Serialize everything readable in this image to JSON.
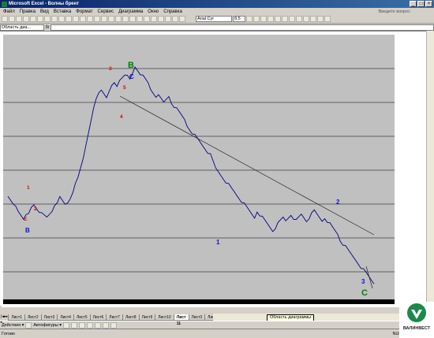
{
  "window": {
    "title": "Microsoft Excel - Волны брент"
  },
  "menu": {
    "items": [
      "Файл",
      "Правка",
      "Вид",
      "Вставка",
      "Формат",
      "Сервис",
      "Диаграмма",
      "Окно",
      "Справка"
    ],
    "ask_placeholder": "Введите вопрос"
  },
  "toolbar": {
    "font_name": "Arial Cyr",
    "font_size": "8,5"
  },
  "formula": {
    "name_box": "Область диа..."
  },
  "tabs": {
    "items": [
      "Лист1",
      "Лист2",
      "Лист3",
      "Лист4",
      "Лист5",
      "Лист6",
      "Лист7",
      "Лист8",
      "Лист9",
      "Лист10",
      "Лист 11",
      "Лист3",
      "Лист2",
      "Лист7"
    ],
    "active_index": 10
  },
  "tooltip": "Область диаграммы",
  "drawing": {
    "actions_label": "Действия ▾",
    "autoshapes_label": "Автофигуры ▾"
  },
  "status": {
    "ready": "Готово",
    "num": "NUM"
  },
  "logo": {
    "name": "ВАЛИНВЕСТ"
  },
  "colors": {
    "plot_bg": "#c0c0c0",
    "line": "#00007f",
    "label_red": "#e00000",
    "label_blue": "#1010d0",
    "label_green": "#008000"
  },
  "chart_data": {
    "type": "line",
    "title": "",
    "xlabel": "",
    "ylabel": "",
    "grid": "horizontal",
    "series": [
      {
        "values": [
          50,
          49,
          48,
          47.5,
          46,
          45,
          44,
          44.5,
          45,
          47,
          48,
          47,
          46,
          45,
          44.5,
          44,
          45,
          46,
          48,
          49,
          50,
          49,
          48,
          48.5,
          50,
          52,
          54,
          56,
          59,
          62,
          66,
          70,
          74,
          77,
          80,
          82,
          83,
          82,
          81,
          82,
          84,
          85,
          84,
          86,
          87,
          88,
          87,
          86,
          88,
          90,
          89,
          88,
          87,
          86,
          85,
          83,
          82,
          81,
          82,
          80,
          79,
          80,
          81,
          79,
          78,
          77,
          76,
          75,
          74,
          72,
          71,
          70,
          69,
          68,
          67,
          66,
          65,
          64,
          63,
          61,
          59,
          58,
          57,
          56,
          55,
          54,
          53,
          52,
          51,
          50,
          49,
          48,
          47,
          46,
          45,
          44,
          46,
          45,
          44,
          43,
          42,
          41,
          40,
          41,
          42,
          43,
          44,
          43,
          44,
          45,
          44,
          43,
          44,
          45,
          44,
          43,
          44,
          45,
          46,
          45,
          44,
          43,
          44,
          43,
          42,
          41,
          40,
          39,
          37,
          36,
          35,
          34,
          33,
          32,
          31,
          30,
          29,
          28,
          27,
          26,
          25,
          24
        ]
      }
    ],
    "annotations": [
      {
        "text": "1",
        "color": "red"
      },
      {
        "text": "2",
        "color": "red"
      },
      {
        "text": "E",
        "color": "red"
      },
      {
        "text": "B",
        "color": "blue"
      },
      {
        "text": "3",
        "color": "red"
      },
      {
        "text": "B",
        "color": "green"
      },
      {
        "text": "C",
        "color": "blue"
      },
      {
        "text": "5",
        "color": "red"
      },
      {
        "text": "4",
        "color": "red"
      },
      {
        "text": "1",
        "color": "blue"
      },
      {
        "text": "2",
        "color": "blue"
      },
      {
        "text": "3",
        "color": "blue"
      },
      {
        "text": "C",
        "color": "green"
      }
    ]
  }
}
